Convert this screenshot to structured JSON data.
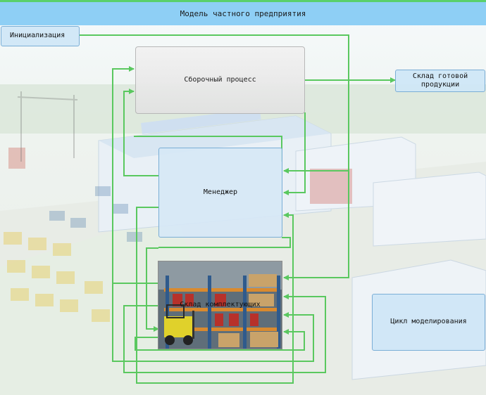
{
  "diagram": {
    "title": "Модель частного предприятия",
    "nodes": {
      "init": "Инициализация",
      "assembly": "Сборочный процесс",
      "warehouse": "Склад готовой\nпродукции",
      "manager": "Менеджер",
      "components": "Склад комплектующих",
      "cycle": "Цикл моделирования"
    },
    "line_color": "#5ac85f"
  }
}
